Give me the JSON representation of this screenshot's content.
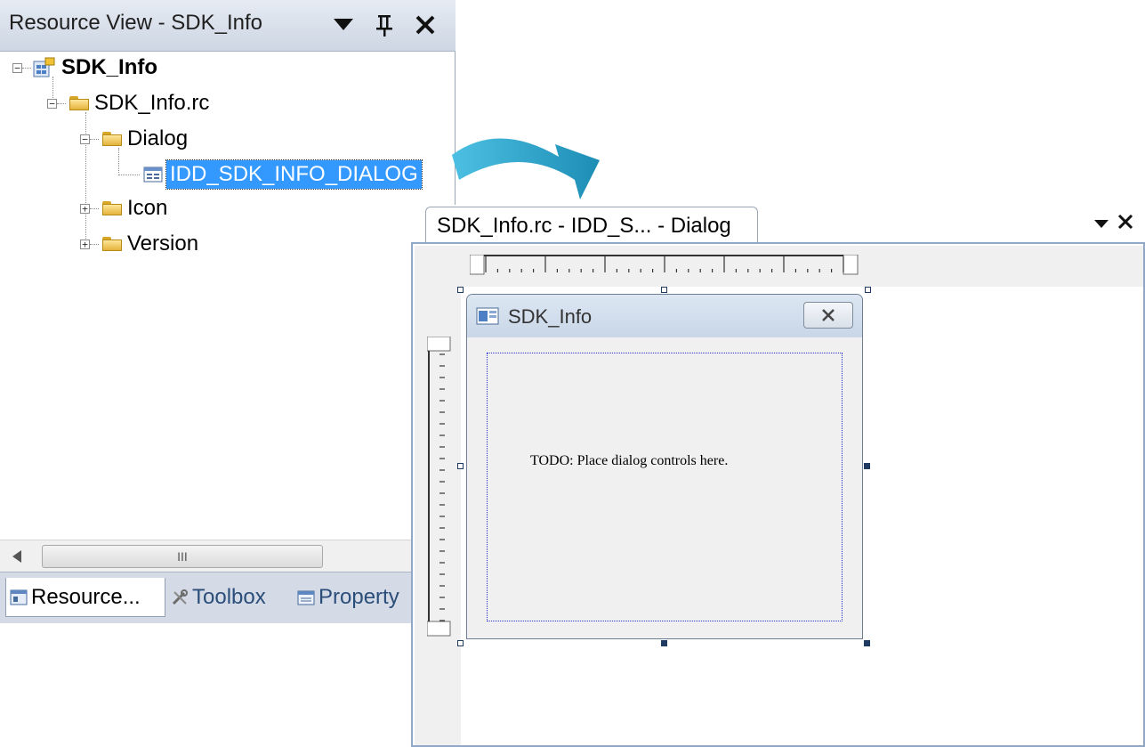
{
  "resource_view": {
    "title": "Resource View - SDK_Info",
    "tree": {
      "root": "SDK_Info",
      "rc_file": "SDK_Info.rc",
      "dialog_folder": "Dialog",
      "dialog_item": "IDD_SDK_INFO_DIALOG",
      "icon_folder": "Icon",
      "version_folder": "Version"
    },
    "scrollbar_grip": "III",
    "tabs": [
      {
        "label": "Resource...",
        "icon": "resource-view-icon"
      },
      {
        "label": "Toolbox",
        "icon": "toolbox-icon"
      },
      {
        "label": "Property",
        "icon": "properties-icon"
      }
    ]
  },
  "editor": {
    "tab_label": "SDK_Info.rc - IDD_S...  - Dialog",
    "dialog": {
      "title": "SDK_Info",
      "placeholder_text": "TODO: Place dialog controls here."
    }
  },
  "colors": {
    "selection": "#3399ff",
    "arrow": "#29a3c9"
  }
}
